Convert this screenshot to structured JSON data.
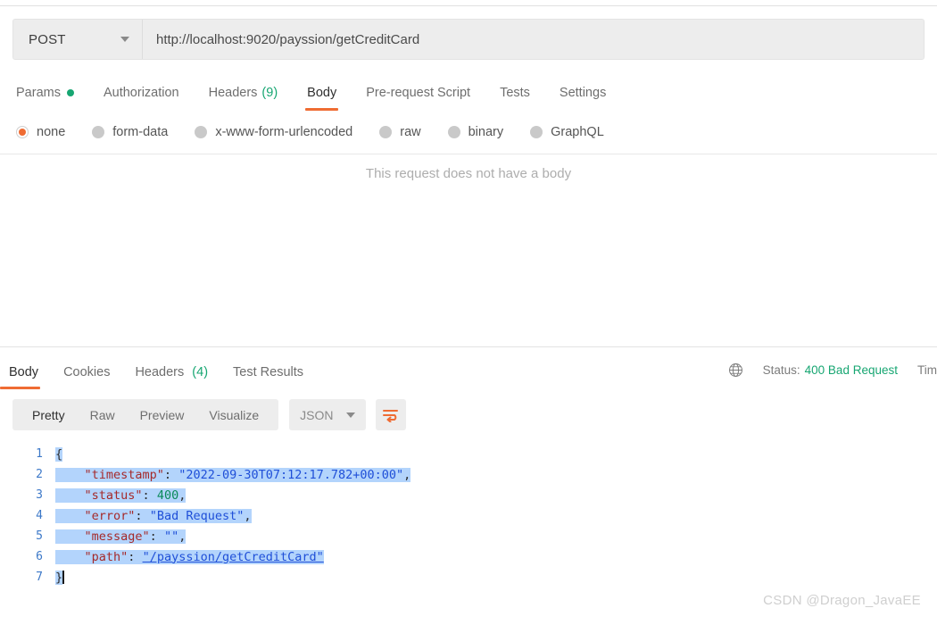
{
  "request": {
    "method": "POST",
    "url": "http://localhost:9020/payssion/getCreditCard",
    "tabs": [
      {
        "label": "Params",
        "badge": "",
        "badge_type": "dot",
        "active": false
      },
      {
        "label": "Authorization",
        "badge": "",
        "badge_type": "none",
        "active": false
      },
      {
        "label": "Headers",
        "badge": "(9)",
        "badge_type": "count",
        "active": false
      },
      {
        "label": "Body",
        "badge": "",
        "badge_type": "none",
        "active": true
      },
      {
        "label": "Pre-request Script",
        "badge": "",
        "badge_type": "none",
        "active": false
      },
      {
        "label": "Tests",
        "badge": "",
        "badge_type": "none",
        "active": false
      },
      {
        "label": "Settings",
        "badge": "",
        "badge_type": "none",
        "active": false
      }
    ],
    "body_types": [
      {
        "label": "none",
        "selected": true
      },
      {
        "label": "form-data",
        "selected": false
      },
      {
        "label": "x-www-form-urlencoded",
        "selected": false
      },
      {
        "label": "raw",
        "selected": false
      },
      {
        "label": "binary",
        "selected": false
      },
      {
        "label": "GraphQL",
        "selected": false
      }
    ],
    "empty_body_message": "This request does not have a body"
  },
  "response": {
    "tabs": [
      {
        "label": "Body",
        "badge": "",
        "active": true
      },
      {
        "label": "Cookies",
        "badge": "",
        "active": false
      },
      {
        "label": "Headers",
        "badge": "(4)",
        "active": false
      },
      {
        "label": "Test Results",
        "badge": "",
        "active": false
      }
    ],
    "status_icon": "globe-icon",
    "status_label": "Status:",
    "status_value": "400 Bad Request",
    "time_label": "Tim",
    "toolbar": {
      "views": [
        {
          "label": "Pretty",
          "active": true
        },
        {
          "label": "Raw",
          "active": false
        },
        {
          "label": "Preview",
          "active": false
        },
        {
          "label": "Visualize",
          "active": false
        }
      ],
      "format": "JSON",
      "wrap_icon": "wrap-text-icon"
    },
    "lines": [
      {
        "num": "1",
        "indent": "",
        "text": "{"
      },
      {
        "num": "2",
        "indent": "    ",
        "key": "\"timestamp\"",
        "value": "\"2022-09-30T07:12:17.782+00:00\"",
        "value_type": "string",
        "comma": true
      },
      {
        "num": "3",
        "indent": "    ",
        "key": "\"status\"",
        "value": "400",
        "value_type": "number",
        "comma": true
      },
      {
        "num": "4",
        "indent": "    ",
        "key": "\"error\"",
        "value": "\"Bad Request\"",
        "value_type": "string",
        "comma": true
      },
      {
        "num": "5",
        "indent": "    ",
        "key": "\"message\"",
        "value": "\"\"",
        "value_type": "string",
        "comma": true
      },
      {
        "num": "6",
        "indent": "    ",
        "key": "\"path\"",
        "value": "\"/payssion/getCreditCard\"",
        "value_type": "link",
        "comma": false
      },
      {
        "num": "7",
        "indent": "",
        "text": "}"
      }
    ]
  },
  "watermark": "CSDN @Dragon_JavaEE",
  "colors": {
    "accent": "#ef6c33",
    "success": "#17a672",
    "selection": "#b3d4fc",
    "json_key": "#a52a2a",
    "json_string": "#1f4fd8",
    "json_number": "#0a8a5a"
  }
}
